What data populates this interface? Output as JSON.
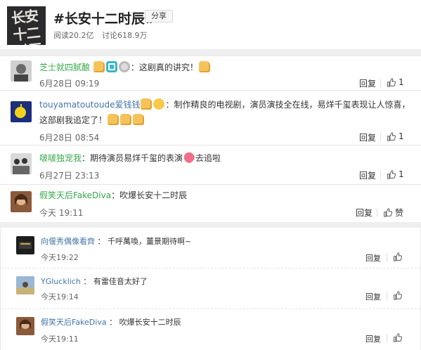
{
  "topic": {
    "cover_text": "长安十二时辰",
    "title": "#长安十二时辰#",
    "share_label": "分享",
    "reads": "阅读20.2亿",
    "discussions": "讨论618.9万"
  },
  "comments_a": [
    {
      "user": "芝士就四腻酿",
      "text": "：这剧真的讲究！",
      "time": "6月28日 09:19",
      "reply_label": "回复",
      "likes": "1"
    },
    {
      "user": "touyamatoutoude爱钱钱",
      "text_line1": "：制作精良的电视剧，演员演技全在线，易烊千玺表现让人惊喜，",
      "text_line2": "这部剧我追定了！",
      "time": "6月28日 08:54",
      "reply_label": "回复",
      "likes": "1"
    },
    {
      "user": "啵啵独宠我",
      "text_a": "：期待演员易烊千玺的表演",
      "text_b": "去追啦",
      "time": "6月27日 23:13",
      "reply_label": "回复",
      "likes": "1"
    },
    {
      "user": "假笑天后FakeDiva",
      "text": "：吹爆长安十二时辰",
      "time": "今天 19:11",
      "reply_label": "回复",
      "likes": "赞"
    }
  ],
  "comments_b": [
    {
      "user": "向偃秀偶像看齊",
      "text": "千呼萬喚，薑景期待啊~",
      "time": "今天19:22",
      "reply_label": "回复"
    },
    {
      "user": "YGlucklich",
      "text": "有雷佳音太好了",
      "time": "今天19:14",
      "reply_label": "回复"
    },
    {
      "user": "假笑天后FakeDiva",
      "text": "吹爆长安十二时辰",
      "time": "今天19:11",
      "reply_label": "回复"
    }
  ],
  "colors": {
    "username_orange": "#eb7350",
    "username_green": "#3aa84d",
    "username_blue": "#4574a9",
    "gap_gray": "#eeeeee"
  },
  "icons": [
    "thumb-up-icon",
    "thumb-emoji",
    "camera-emoji",
    "ring-emoji",
    "sunglasses-emoji",
    "heart-emoji"
  ]
}
